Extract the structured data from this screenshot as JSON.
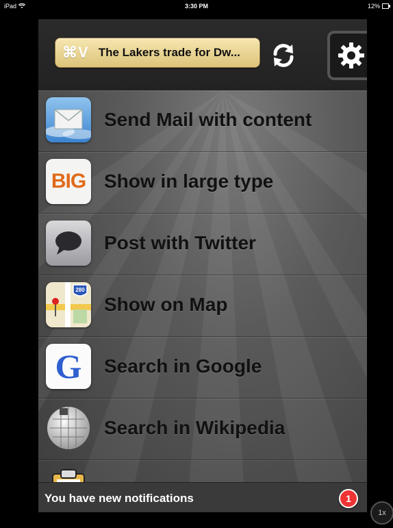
{
  "status_bar": {
    "device": "iPad",
    "time": "3:30 PM",
    "battery": "12%"
  },
  "header": {
    "clip_symbol": "⌘V",
    "clip_text": "The Lakers trade for Dw...",
    "refresh_icon": "refresh-icon",
    "settings_icon": "gear-icon"
  },
  "actions": [
    {
      "label": "Send Mail with content",
      "icon": "mail-icon"
    },
    {
      "label": "Show in large type",
      "icon": "big-type-icon",
      "icon_text": "BIG"
    },
    {
      "label": "Post with Twitter",
      "icon": "twitter-bubble-icon"
    },
    {
      "label": "Show on Map",
      "icon": "map-icon",
      "icon_text": "280"
    },
    {
      "label": "Search in Google",
      "icon": "google-icon",
      "icon_text": "G"
    },
    {
      "label": "Search in Wikipedia",
      "icon": "wikipedia-icon"
    },
    {
      "label": "",
      "icon": "clipboard-icon"
    }
  ],
  "notification": {
    "text": "You have new notifications",
    "count": "1"
  },
  "zoom": {
    "label": "1x"
  },
  "colors": {
    "pill": "#e8d38f",
    "badge": "#e33333",
    "background": "#4a4a4a"
  }
}
